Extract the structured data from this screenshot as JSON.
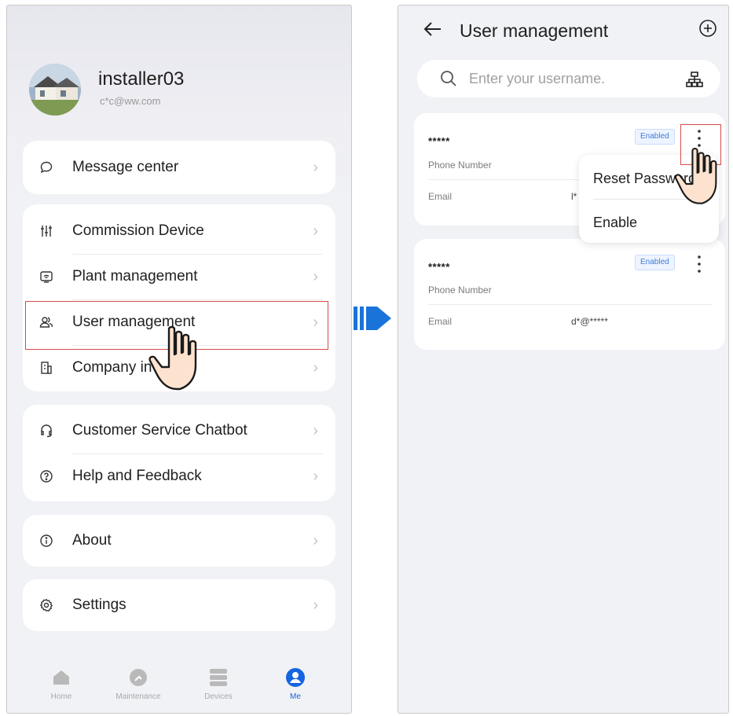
{
  "left_screen": {
    "profile": {
      "name": "installer03",
      "email": "c*c@ww.com"
    },
    "groups": [
      {
        "items": [
          {
            "icon": "chat-bubble-icon",
            "label": "Message center"
          }
        ]
      },
      {
        "items": [
          {
            "icon": "sliders-icon",
            "label": "Commission Device"
          },
          {
            "icon": "plant-icon",
            "label": "Plant management"
          },
          {
            "icon": "users-icon",
            "label": "User management",
            "highlighted": true
          },
          {
            "icon": "company-icon",
            "label": "Company in"
          }
        ]
      },
      {
        "items": [
          {
            "icon": "headset-icon",
            "label": "Customer Service Chatbot"
          },
          {
            "icon": "help-icon",
            "label": "Help and Feedback"
          }
        ]
      },
      {
        "items": [
          {
            "icon": "info-icon",
            "label": "About"
          }
        ]
      },
      {
        "items": [
          {
            "icon": "settings-icon",
            "label": "Settings"
          }
        ]
      }
    ],
    "tabbar": [
      {
        "icon": "home-icon",
        "label": "Home"
      },
      {
        "icon": "maintenance-icon",
        "label": "Maintenance"
      },
      {
        "icon": "devices-icon",
        "label": "Devices"
      },
      {
        "icon": "me-icon",
        "label": "Me",
        "active": true
      }
    ]
  },
  "right_screen": {
    "title": "User management",
    "search_placeholder": "Enter your username.",
    "users": [
      {
        "username": "*****",
        "status": "Enabled",
        "phone_label": "Phone Number",
        "phone_value": "",
        "email_label": "Email",
        "email_value": "l*"
      },
      {
        "username": "*****",
        "status": "Enabled",
        "phone_label": "Phone Number",
        "phone_value": "",
        "email_label": "Email",
        "email_value": "d*@*****"
      }
    ],
    "context_menu": {
      "items": [
        "Reset Password",
        "Enable"
      ]
    }
  },
  "colors": {
    "accent": "#1565e0",
    "highlight": "#d94b4b",
    "arrow": "#1a73d9",
    "badge_text": "#3d7bdc"
  }
}
